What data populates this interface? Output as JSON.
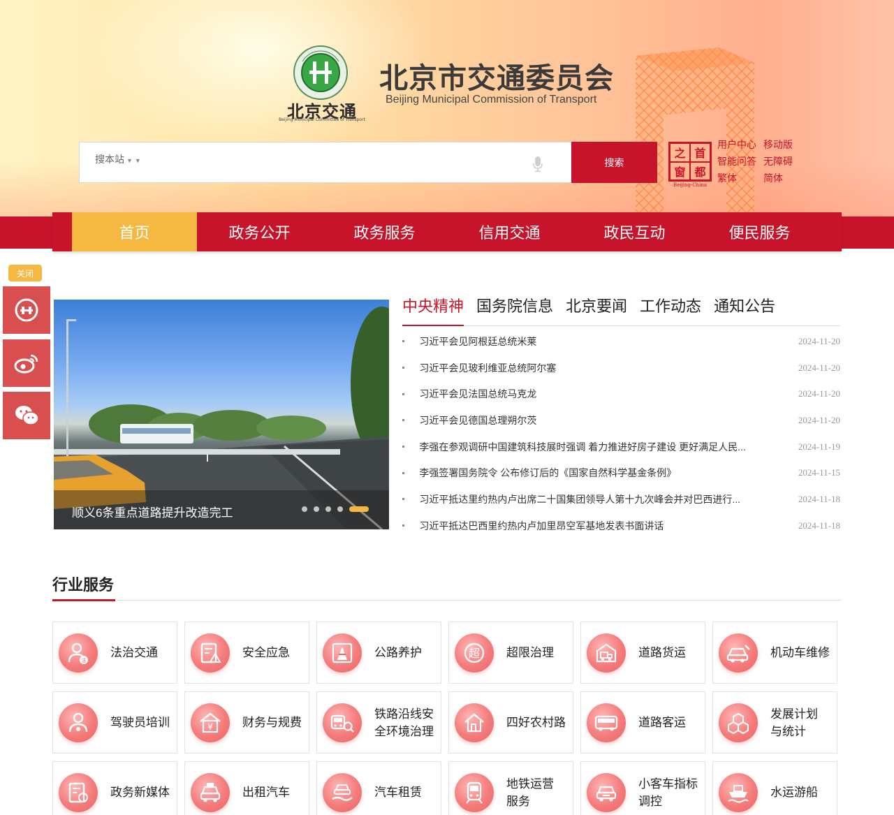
{
  "header": {
    "logo_cn": "北京交通",
    "logo_small_en": "Beijing Municipal Committee of Transport",
    "title": "北京市交通委员会",
    "subtitle": "Beijing Municipal Commission of Transport"
  },
  "search": {
    "scope_label": "搜本站",
    "placeholder": "",
    "button_label": "搜索"
  },
  "capital_window": {
    "chars": [
      "之",
      "首",
      "窗",
      "都"
    ],
    "en": "Beijing-China"
  },
  "quick_links": [
    "用户中心",
    "移动版",
    "智能问答",
    "无障碍",
    "繁体",
    "简体"
  ],
  "nav": {
    "items": [
      "首页",
      "政务公开",
      "政务服务",
      "信用交通",
      "政民互动",
      "便民服务"
    ],
    "active_index": 0
  },
  "float": {
    "close_label": "关闭"
  },
  "carousel": {
    "caption": "顺义6条重点道路提升改造完工",
    "slide_count": 5,
    "active_index": 4
  },
  "news": {
    "tabs": [
      "中央精神",
      "国务院信息",
      "北京要闻",
      "工作动态",
      "通知公告"
    ],
    "active_tab": 0,
    "items": [
      {
        "title": "习近平会见阿根廷总统米莱",
        "date": "2024-11-20"
      },
      {
        "title": "习近平会见玻利维亚总统阿尔塞",
        "date": "2024-11-20"
      },
      {
        "title": "习近平会见法国总统马克龙",
        "date": "2024-11-20"
      },
      {
        "title": "习近平会见德国总理朔尔茨",
        "date": "2024-11-20"
      },
      {
        "title": "李强在参观调研中国建筑科技展时强调 着力推进好房子建设 更好满足人民...",
        "date": "2024-11-19"
      },
      {
        "title": "李强签署国务院令 公布修订后的《国家自然科学基金条例》",
        "date": "2024-11-15"
      },
      {
        "title": "习近平抵达里约热内卢出席二十国集团领导人第十九次峰会并对巴西进行...",
        "date": "2024-11-18"
      },
      {
        "title": "习近平抵达巴西里约热内卢加里昂空军基地发表书面讲话",
        "date": "2024-11-18"
      }
    ]
  },
  "services": {
    "title": "行业服务",
    "items": [
      {
        "label": "法治交通",
        "icon": "law-person-icon"
      },
      {
        "label": "安全应急",
        "icon": "safety-document-icon"
      },
      {
        "label": "公路养护",
        "icon": "traffic-cone-icon"
      },
      {
        "label": "超限治理",
        "icon": "overload-badge-icon"
      },
      {
        "label": "道路货运",
        "icon": "cargo-truck-icon"
      },
      {
        "label": "机动车维修",
        "icon": "car-repair-icon"
      },
      {
        "label": "驾驶员培训",
        "icon": "driver-person-icon"
      },
      {
        "label": "财务与规费",
        "icon": "finance-yuan-icon"
      },
      {
        "label": "铁路沿线安\n全环境治理",
        "icon": "railway-safety-icon"
      },
      {
        "label": "四好农村路",
        "icon": "rural-house-icon"
      },
      {
        "label": "道路客运",
        "icon": "bus-icon"
      },
      {
        "label": "发展计划\n与统计",
        "icon": "cubes-icon"
      },
      {
        "label": "政务新媒体",
        "icon": "media-document-icon"
      },
      {
        "label": "出租汽车",
        "icon": "taxi-icon"
      },
      {
        "label": "汽车租赁",
        "icon": "car-rental-icon"
      },
      {
        "label": "地铁运营\n服务",
        "icon": "subway-icon"
      },
      {
        "label": "小客车指标\n调控",
        "icon": "passenger-car-icon"
      },
      {
        "label": "水运游船",
        "icon": "boat-icon"
      }
    ]
  },
  "colors": {
    "brand_red": "#c8142a",
    "accent_gold": "#f5b942",
    "icon_pink": "#f47b7b"
  }
}
